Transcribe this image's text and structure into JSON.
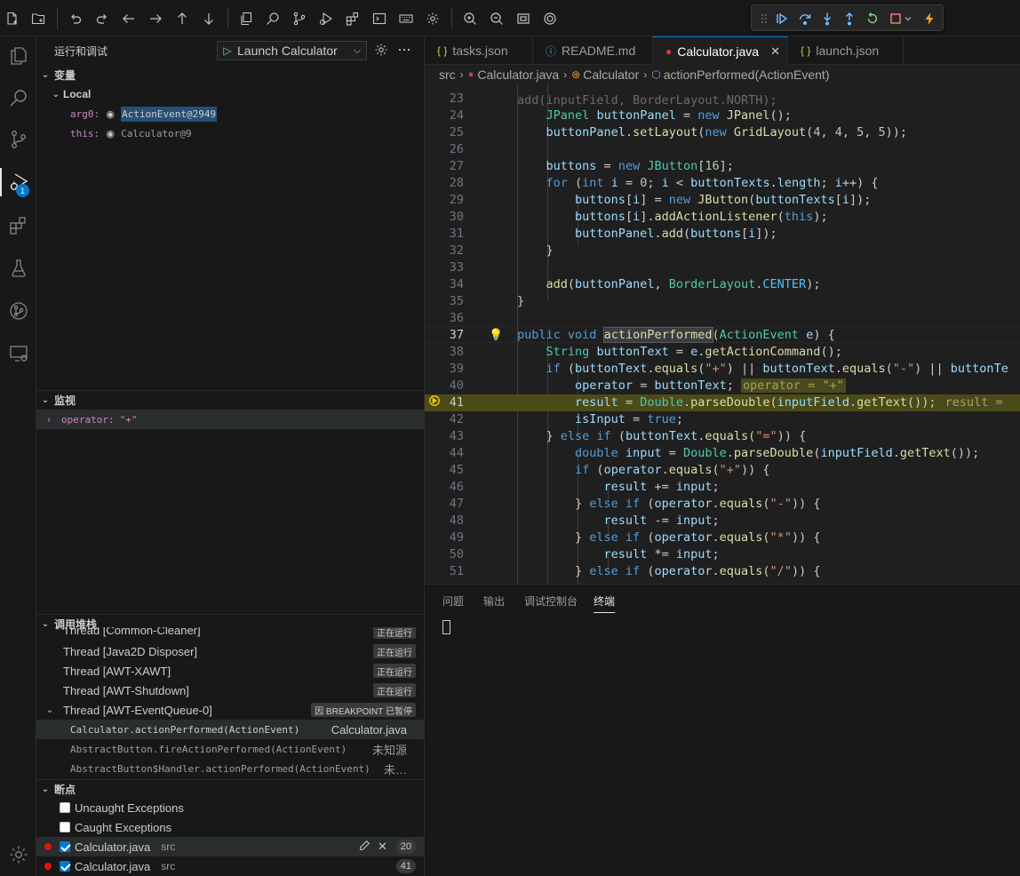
{
  "toolbar": {
    "icons": [
      "new-file-icon",
      "new-folder-icon",
      "undo-icon",
      "redo-icon",
      "arrow-left-icon",
      "arrow-right-icon",
      "arrow-up-icon",
      "arrow-down-icon",
      "copy-icon",
      "search-icon",
      "source-control-icon",
      "run-debug-icon",
      "extensions-icon",
      "terminal-icon",
      "keyboard-icon",
      "settings-icon",
      "zoom-in-icon",
      "zoom-out-icon",
      "fit-screen-icon",
      "target-icon"
    ]
  },
  "debug_toolbar": {
    "icons": [
      "drag-handle-icon",
      "continue-icon",
      "step-over-icon",
      "step-into-icon",
      "step-out-icon",
      "restart-icon",
      "stop-icon",
      "hot-reload-icon"
    ],
    "colors": {
      "continue": "#75beff",
      "restart": "#89d185",
      "stop": "#f48771",
      "hot": "#f5a623"
    }
  },
  "activity": {
    "items": [
      "explorer-icon",
      "search-icon",
      "source-control-icon",
      "run-debug-icon",
      "extensions-icon",
      "testing-icon",
      "git-graph-icon",
      "remote-explorer-icon"
    ],
    "debug_badge": "1",
    "settings": "manage-gear-icon"
  },
  "sidebar": {
    "title": "运行和调试",
    "launch_config": "Launch Calculator",
    "variables": {
      "title": "变量",
      "scope": "Local",
      "items": [
        {
          "name": "arg0:",
          "value": "ActionEvent@2949"
        },
        {
          "name": "this:",
          "value": "Calculator@9"
        }
      ]
    },
    "watch": {
      "title": "监视",
      "items": [
        {
          "name": "operator:",
          "value": "\"+\""
        }
      ]
    },
    "call_stack": {
      "title": "调用堆栈",
      "threads": [
        {
          "name": "Thread [Common-Cleaner]",
          "status": "正在运行"
        },
        {
          "name": "Thread [Java2D Disposer]",
          "status": "正在运行"
        },
        {
          "name": "Thread [AWT-XAWT]",
          "status": "正在运行"
        },
        {
          "name": "Thread [AWT-Shutdown]",
          "status": "正在运行"
        },
        {
          "name": "Thread [AWT-EventQueue-0]",
          "status": "因 BREAKPOINT 已暂停"
        }
      ],
      "frames": [
        {
          "fn": "Calculator.actionPerformed(ActionEvent)",
          "src": "Calculator.java"
        },
        {
          "fn": "AbstractButton.fireActionPerformed(ActionEvent)",
          "src": "未知源"
        },
        {
          "fn": "AbstractButton$Handler.actionPerformed(ActionEvent)",
          "src": "未…"
        }
      ]
    },
    "breakpoints": {
      "title": "断点",
      "exceptions": [
        "Uncaught Exceptions",
        "Caught Exceptions"
      ],
      "items": [
        {
          "file": "Calculator.java",
          "dir": "src",
          "line": "20"
        },
        {
          "file": "Calculator.java",
          "dir": "src",
          "line": "41"
        }
      ]
    }
  },
  "tabs": [
    {
      "icon": "{ }",
      "label": "tasks.json"
    },
    {
      "icon": "ⓘ",
      "label": "README.md"
    },
    {
      "icon": "●",
      "label": "Calculator.java",
      "close": "✕"
    },
    {
      "icon": "{ }",
      "label": "launch.json"
    }
  ],
  "breadcrumb": [
    "src",
    "Calculator.java",
    "Calculator",
    "actionPerformed(ActionEvent)"
  ],
  "editor": {
    "partial_top": "add(inputField, BorderLayout.NORTH);",
    "line_numbers": [
      "23",
      "24",
      "25",
      "26",
      "27",
      "28",
      "29",
      "30",
      "31",
      "32",
      "33",
      "34",
      "35",
      "36",
      "37",
      "38",
      "39",
      "40",
      "41",
      "42",
      "43",
      "44",
      "45",
      "46",
      "47",
      "48",
      "49",
      "50",
      "51"
    ],
    "inline_values": {
      "l40": "operator = \"+\"",
      "l41": "result ="
    }
  },
  "panel": {
    "tabs": [
      "问题",
      "输出",
      "调试控制台",
      "终端"
    ]
  }
}
